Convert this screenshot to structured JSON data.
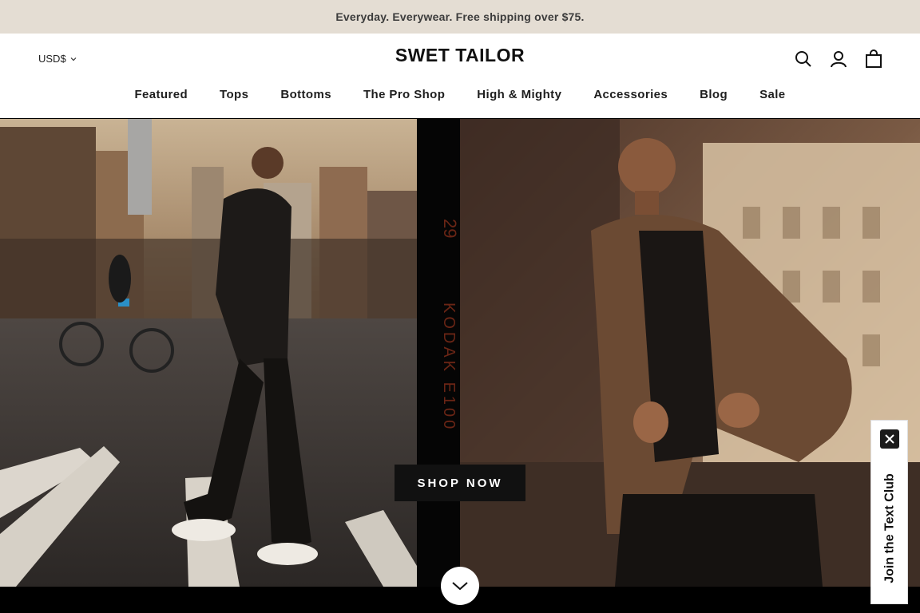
{
  "announcement": "Everyday. Everywear. Free shipping over $75.",
  "header": {
    "currency": "USD$",
    "logo": "SWET TAILOR",
    "icons": [
      "search-icon",
      "account-icon",
      "cart-icon"
    ]
  },
  "nav": {
    "items": [
      "Featured",
      "Tops",
      "Bottoms",
      "The Pro Shop",
      "High & Mighty",
      "Accessories",
      "Blog",
      "Sale"
    ]
  },
  "hero": {
    "cta": "SHOP NOW",
    "film_text_top": "29",
    "film_text_bottom": "KODAK E100"
  },
  "popup": {
    "label": "Join the Text Club"
  },
  "colors": {
    "announcement_bg": "#e4ddd3",
    "button_bg": "#111111",
    "accent": "#ffffff"
  }
}
